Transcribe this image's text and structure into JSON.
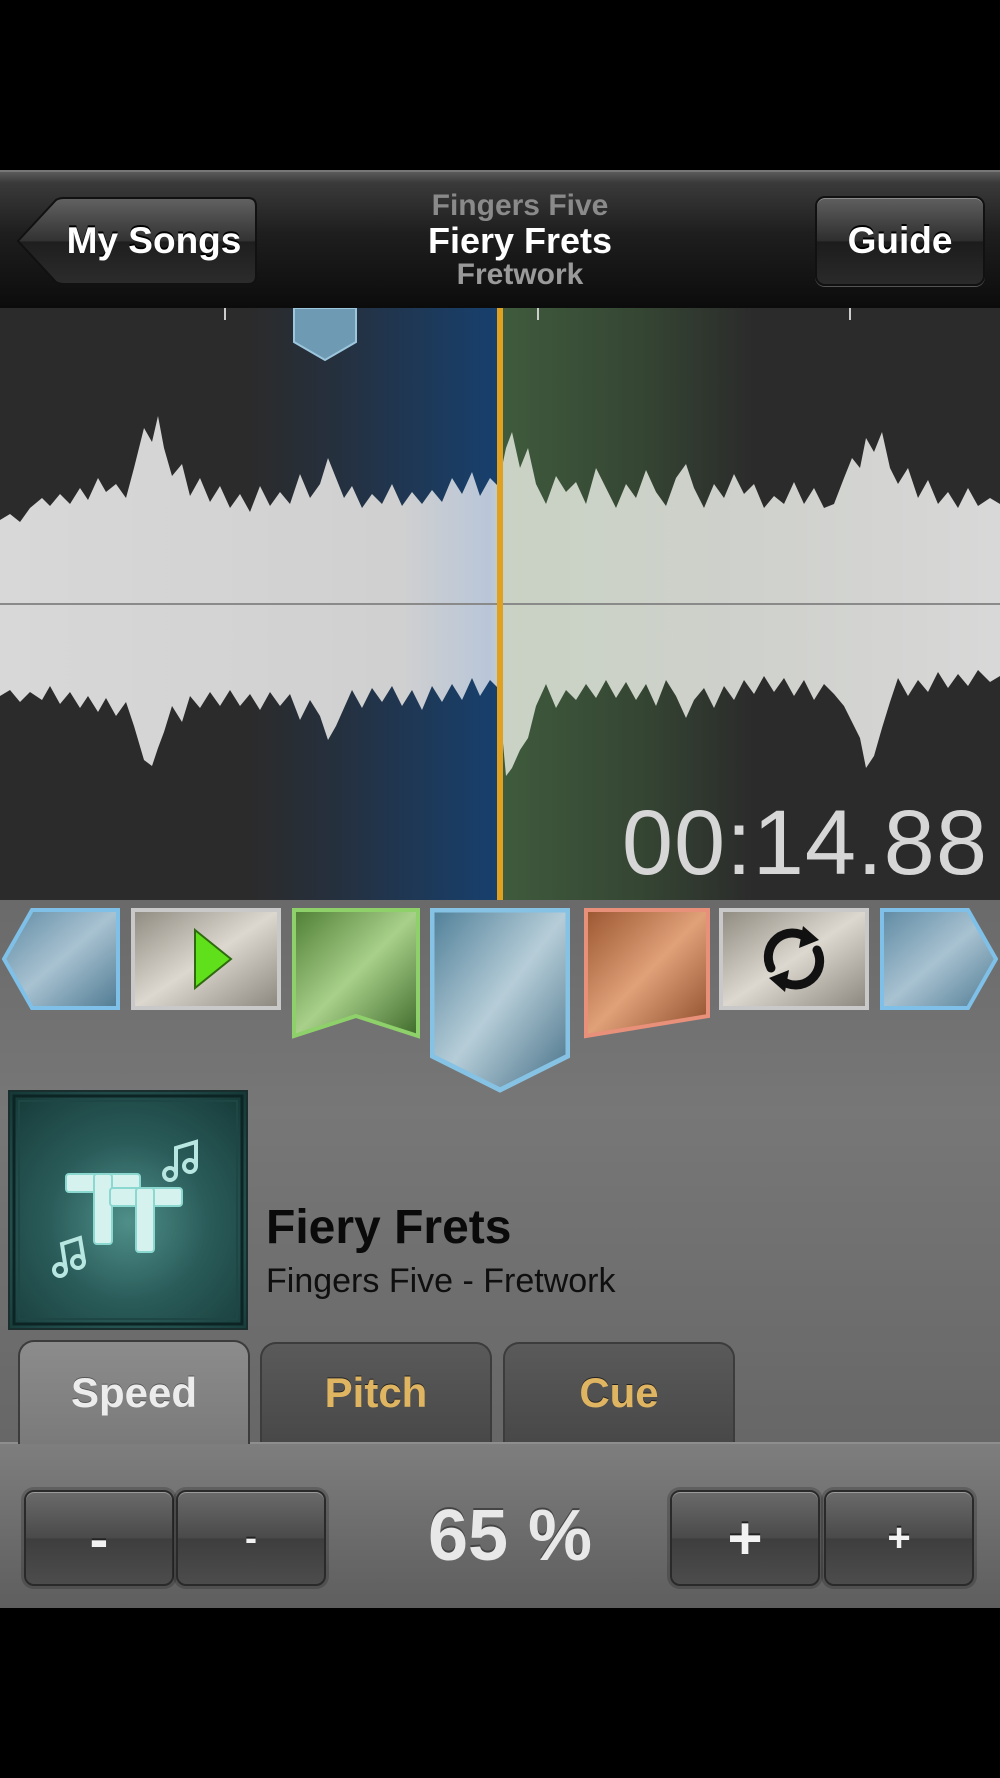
{
  "nav": {
    "back_label": "My Songs",
    "guide_label": "Guide",
    "artist": "Fingers Five",
    "song": "Fiery Frets",
    "album": "Fretwork"
  },
  "waveform": {
    "time": "00:14.88"
  },
  "controls": {
    "items": [
      "left-arrow",
      "play",
      "green-marker",
      "blue-marker",
      "orange-marker",
      "loop",
      "right-arrow"
    ]
  },
  "now_playing": {
    "title": "Fiery Frets",
    "subtitle": "Fingers Five - Fretwork"
  },
  "tabs": [
    {
      "label": "Speed",
      "active": true
    },
    {
      "label": "Pitch",
      "active": false
    },
    {
      "label": "Cue",
      "active": false
    }
  ],
  "speed": {
    "value": "65 %",
    "minus_large": "-",
    "minus_small": "-",
    "plus_large": "+",
    "plus_small": "+"
  },
  "colors": {
    "playhead": "#e0a020",
    "blue_section": "#1c3f6a",
    "green_section": "#3d5a3c",
    "tab_inactive_text": "#e0b562"
  }
}
